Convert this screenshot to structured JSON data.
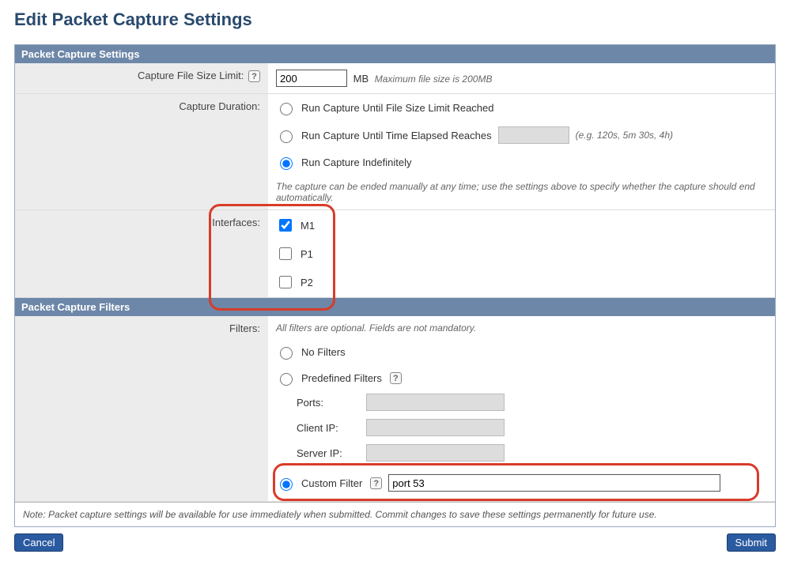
{
  "pageTitle": "Edit Packet Capture Settings",
  "settingsHeader": "Packet Capture Settings",
  "filtersHeader": "Packet Capture Filters",
  "fileSize": {
    "label": "Capture File Size Limit:",
    "value": "200",
    "unit": "MB",
    "note": "Maximum file size is 200MB"
  },
  "duration": {
    "label": "Capture Duration:",
    "optFileSize": "Run Capture Until File Size Limit Reached",
    "optTimeElapsed": "Run Capture Until Time Elapsed Reaches",
    "timeValue": "",
    "timeHint": "(e.g. 120s, 5m 30s, 4h)",
    "optIndefinite": "Run Capture Indefinitely",
    "note": "The capture can be ended manually at any time; use the settings above to specify whether the capture should end automatically."
  },
  "interfaces": {
    "label": "Interfaces:",
    "items": [
      {
        "name": "M1",
        "checked": true
      },
      {
        "name": "P1",
        "checked": false
      },
      {
        "name": "P2",
        "checked": false
      }
    ]
  },
  "filters": {
    "label": "Filters:",
    "intro": "All filters are optional. Fields are not mandatory.",
    "optNone": "No Filters",
    "optPredefined": "Predefined Filters",
    "predef": {
      "portsLabel": "Ports:",
      "portsValue": "",
      "clientLabel": "Client IP:",
      "clientValue": "",
      "serverLabel": "Server IP:",
      "serverValue": ""
    },
    "optCustom": "Custom Filter",
    "customValue": "port 53"
  },
  "footerNote": "Note: Packet capture settings will be available for use immediately when submitted. Commit changes to save these settings permanently for future use.",
  "buttons": {
    "cancel": "Cancel",
    "submit": "Submit"
  }
}
